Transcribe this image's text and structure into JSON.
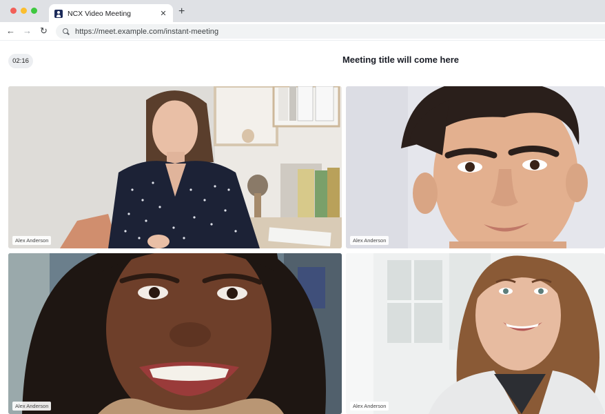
{
  "browser": {
    "tab_title": "NCX Video Meeting",
    "tab_close": "✕",
    "new_tab": "+",
    "back": "←",
    "forward": "→",
    "reload": "↻",
    "url": "https://meet.example.com/instant-meeting"
  },
  "meeting": {
    "timer": "02:16",
    "title": "Meeting title will come here"
  },
  "participants": [
    {
      "name": "Alex Anderson"
    },
    {
      "name": "Alex Anderson"
    },
    {
      "name": "Alex Anderson"
    },
    {
      "name": "Alex Anderson"
    }
  ],
  "colors": {
    "chrome_bg": "#dfe1e5",
    "omnibox_bg": "#f1f3f4",
    "title_text": "#1a1d26"
  }
}
